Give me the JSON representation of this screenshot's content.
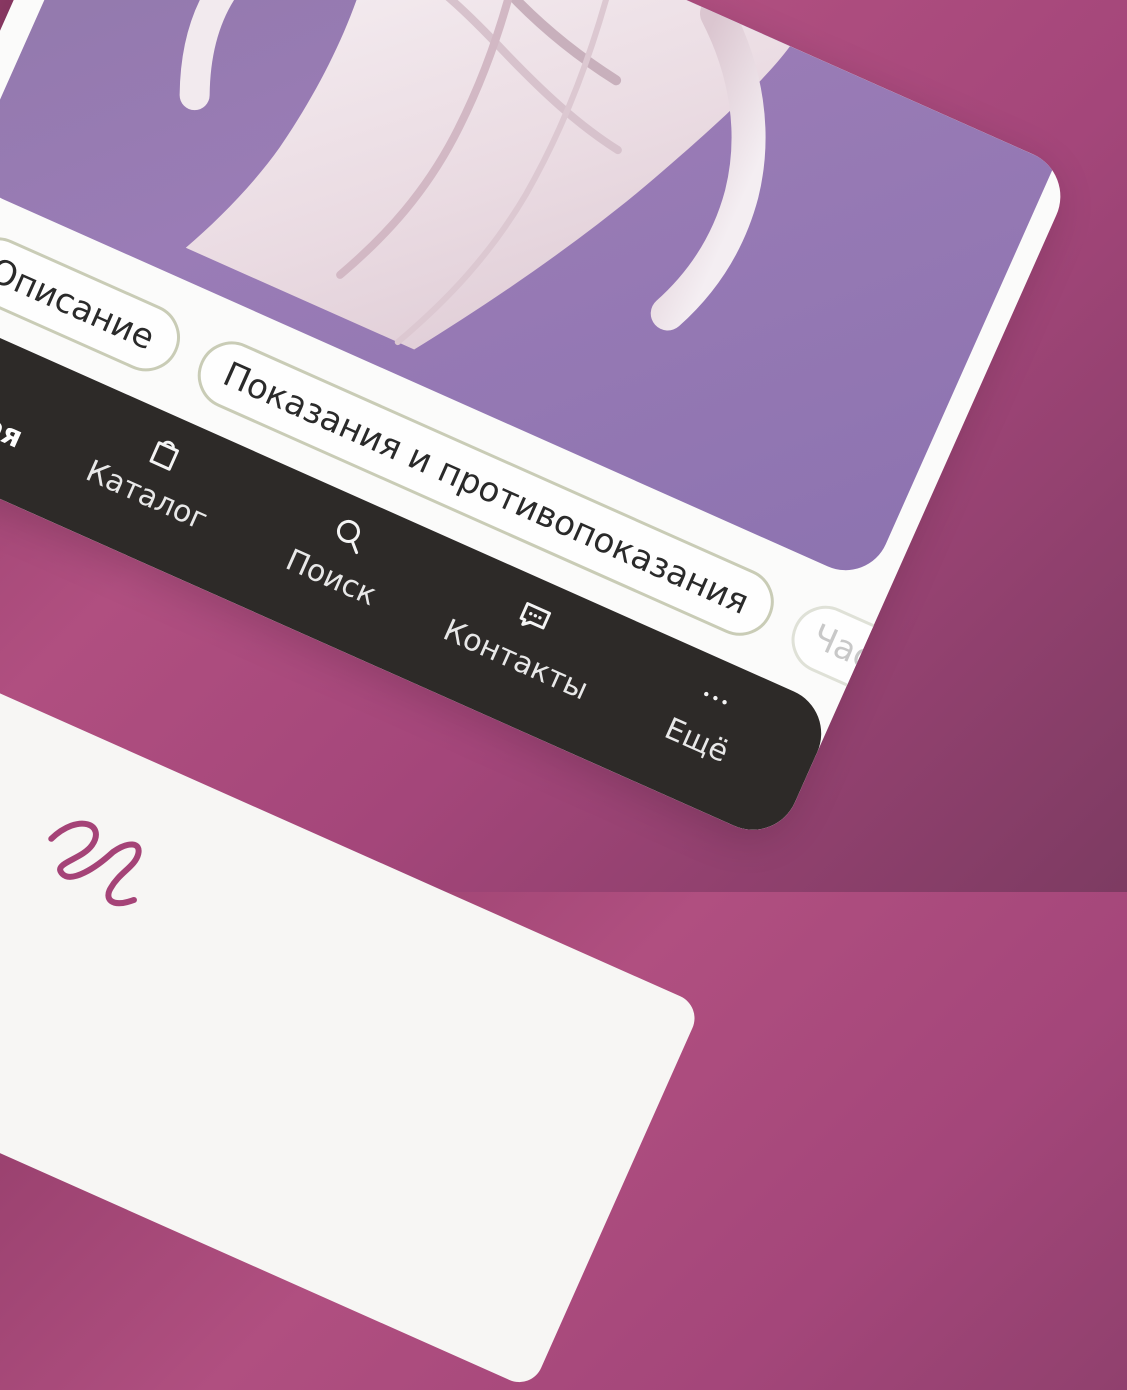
{
  "tabs": [
    {
      "label": "Описание"
    },
    {
      "label": "Показания и противопоказания"
    },
    {
      "label": "Час"
    }
  ],
  "bottom_nav": {
    "items": [
      {
        "label": "Главная",
        "icon": "home-icon",
        "active": true
      },
      {
        "label": "Каталог",
        "icon": "bag-icon",
        "active": false
      },
      {
        "label": "Поиск",
        "icon": "search-icon",
        "active": false
      },
      {
        "label": "Контакты",
        "icon": "chat-icon",
        "active": false
      },
      {
        "label": "Ещё",
        "icon": "more-icon",
        "active": false
      }
    ]
  },
  "colors": {
    "background_gradient_start": "#8e3a66",
    "background_gradient_mid": "#b04f80",
    "screen_bg": "#fbfbfa",
    "photo_bg": "#9a7cb6",
    "nav_bg": "#2d2a28",
    "nav_text": "#e8e8e8",
    "active_icon": "#d4578c",
    "tab_border": "#c9ccb6",
    "tab_text": "#2a2a2a"
  }
}
